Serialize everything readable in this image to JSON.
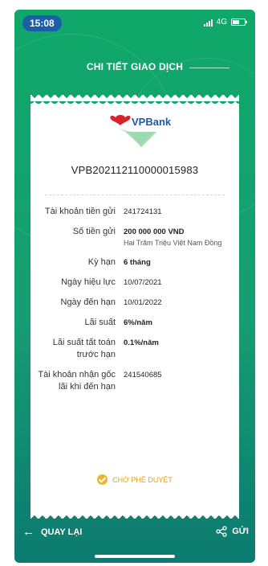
{
  "status_bar": {
    "time": "15:08",
    "network": "4G"
  },
  "header": {
    "title": "CHI TIẾT GIAO DỊCH"
  },
  "receipt": {
    "logo_text": "VPBank",
    "reference": "VPB202112110000015983",
    "rows": [
      {
        "label": "Tài khoản tiền gửi",
        "value": "241724131",
        "bold": false
      },
      {
        "label": "Số tiền gửi",
        "value": "200 000 000 VND",
        "sub": "Hai Trăm Triệu Việt Nam Đồng",
        "bold": true
      },
      {
        "label": "Kỳ hạn",
        "value": "6 tháng",
        "bold": true
      },
      {
        "label": "Ngày hiệu lực",
        "value": "10/07/2021",
        "bold": false
      },
      {
        "label": "Ngày đến hạn",
        "value": "10/01/2022",
        "bold": false
      },
      {
        "label": "Lãi suất",
        "value": "6%/năm",
        "bold": true
      },
      {
        "label": "Lãi suất tất toán trước hạn",
        "value": "0.1%/năm",
        "bold": true
      },
      {
        "label": "Tài khoản nhận gốc lãi khi đến hạn",
        "value": "241540685",
        "bold": false
      }
    ],
    "status": "CHỜ PHÊ DUYỆT",
    "status_color": "#e0a21c"
  },
  "footer": {
    "back_label": "QUAY LẠI",
    "send_label": "GỬI"
  },
  "colors": {
    "background_top": "#0fa86a",
    "background_bottom": "#0c7a70",
    "time_pill": "#1a5ea8",
    "brand_blue": "#1b5aa8",
    "brand_red": "#d6262d"
  },
  "icons": {
    "back": "arrow-left-icon",
    "share": "share-icon",
    "status": "check-circle-icon"
  }
}
